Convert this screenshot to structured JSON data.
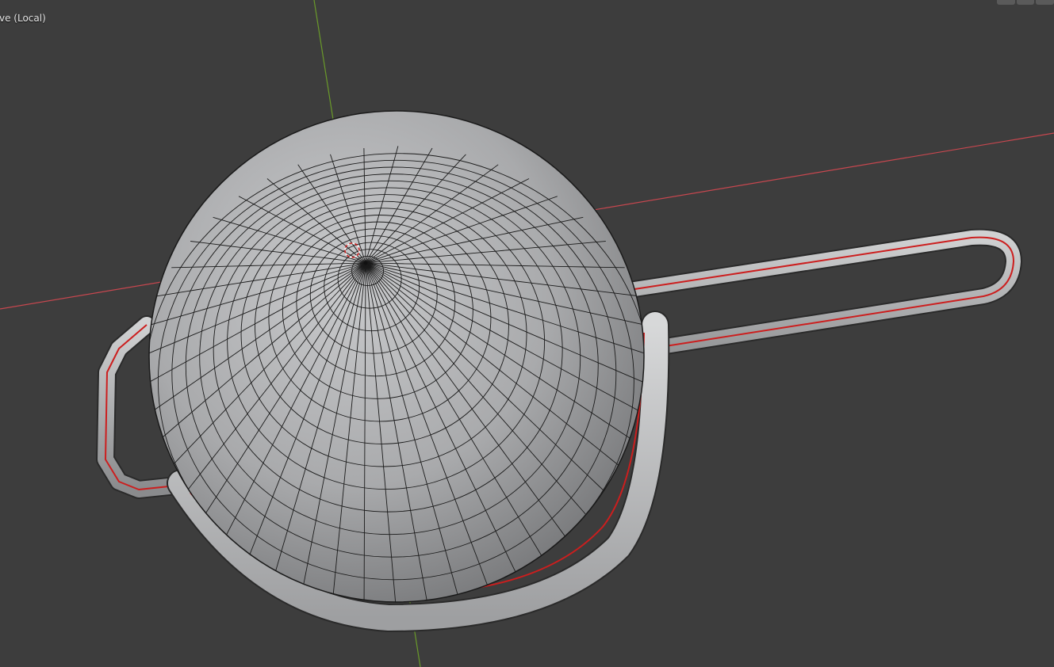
{
  "viewport": {
    "view_label": "ve (Local)",
    "background_color": "#3d3d3d",
    "axis_x_color": "#c8474f",
    "axis_y_color": "#6a9a2a",
    "seam_color": "#cc1e1e",
    "wire_color": "#1a1a1a"
  },
  "scene": {
    "object": "colander-mesh",
    "parts": [
      "bowl-sphere",
      "rim-ring",
      "long-handle",
      "side-handle"
    ],
    "origin_marker": "3d-cursor-icon"
  },
  "gizmo": {
    "buttons": [
      "view-button-1",
      "view-button-2",
      "view-button-3"
    ]
  }
}
